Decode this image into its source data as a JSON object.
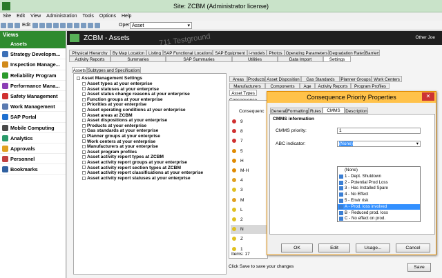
{
  "window": {
    "title": "Site: ZCBM (Administrator license)"
  },
  "menu": [
    "Site",
    "Edit",
    "View",
    "Administration",
    "Tools",
    "Options",
    "Help"
  ],
  "toolbar": {
    "edit_label": "Edit",
    "open_label": "Open:",
    "open_value": "Asset"
  },
  "sidebar": {
    "header": "Views",
    "items": [
      {
        "label": "Assets",
        "color": "#2e8b2e",
        "active": true
      },
      {
        "label": "Strategy Developm...",
        "color": "#3b6fb6"
      },
      {
        "label": "Inspection Manage...",
        "color": "#d18a1a"
      },
      {
        "label": "Reliability Program",
        "color": "#2a9a2a"
      },
      {
        "label": "Performance Mana...",
        "color": "#8b3db5"
      },
      {
        "label": "Safety Management",
        "color": "#d03030"
      },
      {
        "label": "Work Management",
        "color": "#5a7ab0"
      },
      {
        "label": "SAP Portal",
        "color": "#1d6fd0"
      },
      {
        "label": "Mobile Computing",
        "color": "#4a4a4a"
      },
      {
        "label": "Analytics",
        "color": "#2a9a6a"
      },
      {
        "label": "Approvals",
        "color": "#e0a020"
      },
      {
        "label": "Personnel",
        "color": "#c04040"
      },
      {
        "label": "Bookmarks",
        "color": "#3060a0"
      }
    ]
  },
  "main": {
    "title": "ZCBM - Assets",
    "user": "Other Joe"
  },
  "tabs_row1": [
    "Physical Hierarchy",
    "By Map Location",
    "Listing",
    "SAP Functional Locations",
    "SAP Equipment",
    "i-models",
    "Photos",
    "Operating Parameters",
    "Degradation Rates",
    "Barriers"
  ],
  "tabs_row2": [
    "Activity Reports",
    "Summaries",
    "SAP Summaries",
    "Utilities",
    "Data Import",
    "Settings"
  ],
  "subtabs": [
    "Assets",
    "Subtypes and Specifications"
  ],
  "tree": {
    "root": "Asset Management Settings",
    "items": [
      "Asset types at your enterprise",
      "Asset statuses at your enterprise",
      "Asset status change reasons at your enterprise",
      "Function groups at your enterprise",
      "Priorities at your enterprise",
      "Asset operating conditions at your enterprise",
      "Asset areas at ZCBM",
      "Asset dispositions at your enterprise",
      "Products at your enterprise",
      "Gas standards at your enterprise",
      "Planner groups at your enterprise",
      "Work centers at your enterprise",
      "Manufacturers at your enterprise",
      "Asset program profiles",
      "Asset activity report types at ZCBM",
      "Asset activity report groups at your enterprise",
      "Asset activity report section types at ZCBM",
      "Asset activity report classifications at your enterprise",
      "Asset activity report statuses at your enterprise"
    ]
  },
  "right_tabs_row1": [
    "Areas",
    "Products",
    "Asset Disposition",
    "Gas Standards",
    "Planner Groups",
    "Work Centers"
  ],
  "right_tabs_row2": [
    "Manufacturers",
    "Components",
    "Age",
    "Activity Reports",
    "Program Profiles"
  ],
  "right_tabs_row3": [
    "Asset Types"
  ],
  "grid": {
    "header": "Consequence",
    "col_header": "Consequenc",
    "rows": [
      {
        "v": "9",
        "c": "#d03030"
      },
      {
        "v": "8",
        "c": "#d03030"
      },
      {
        "v": "7",
        "c": "#d03030"
      },
      {
        "v": "5",
        "c": "#e08a00"
      },
      {
        "v": "H",
        "c": "#e08a00"
      },
      {
        "v": "M-H",
        "c": "#e08a00"
      },
      {
        "v": "4",
        "c": "#e0a020"
      },
      {
        "v": "3",
        "c": "#e0c020"
      },
      {
        "v": "M",
        "c": "#e0a020"
      },
      {
        "v": "L",
        "c": "#e0c020"
      },
      {
        "v": "2",
        "c": "#e0c020"
      },
      {
        "v": "N",
        "c": "#e0c020"
      },
      {
        "v": "Z",
        "c": "#e0c020"
      },
      {
        "v": "1",
        "c": "#e0c020"
      }
    ],
    "items_label": "Items: 17"
  },
  "status": {
    "text": "Click Save to save your changes",
    "save": "Save"
  },
  "dialog": {
    "title": "Consequence Priority Properties",
    "tabs": [
      "General",
      "Formatting",
      "Rules",
      "CMMS Info",
      "Description"
    ],
    "section": "CMMS information",
    "priority_label": "CMMS priority:",
    "priority_value": "1",
    "abc_label": "ABC indicator:",
    "abc_value": "(None)",
    "options": [
      "(None)",
      "1 - Dept. Shutdown",
      "2 - Potential Prod Loss",
      "3 - Has Installed Spare",
      "4 - No Effect",
      "5 - Envir risk",
      "A - Prod. loss involved",
      "B - Reduced prod. loss",
      "C - No effect on prod."
    ],
    "highlighted": "A - Prod. loss involved",
    "buttons": {
      "ok": "OK",
      "edit": "Edit",
      "usage": "Usage...",
      "cancel": "Cancel"
    }
  },
  "watermark": "711 Testground"
}
